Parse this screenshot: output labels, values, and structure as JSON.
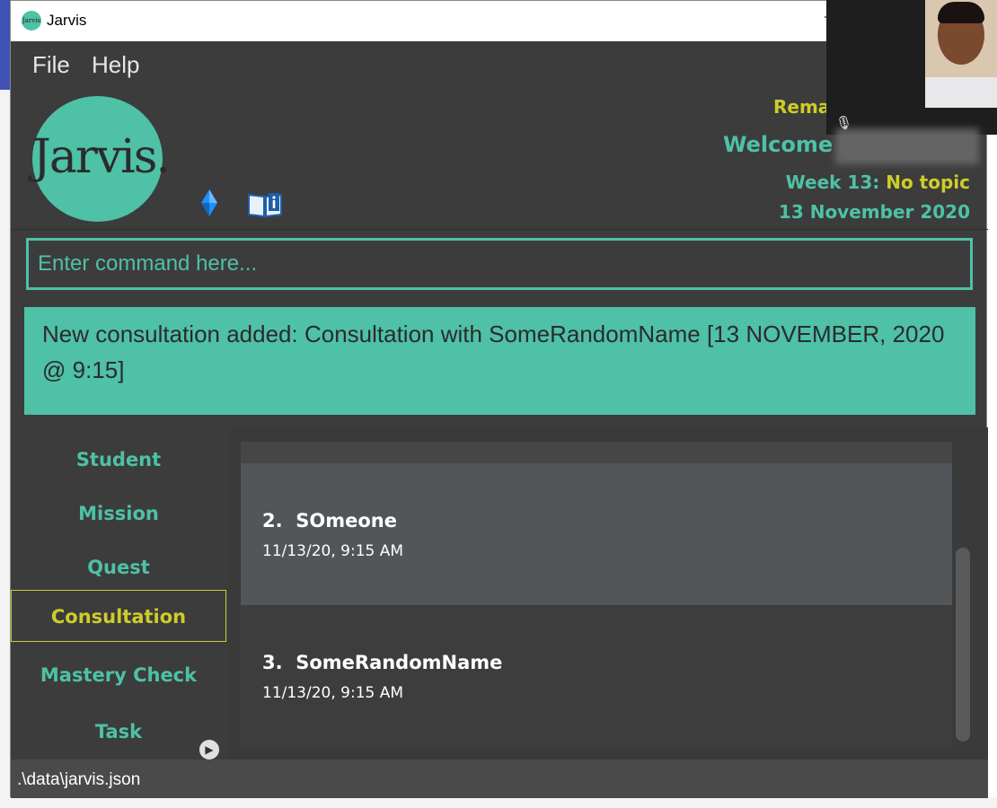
{
  "window": {
    "title": "Jarvis",
    "icon_text": "Jarvis"
  },
  "menu": {
    "items": [
      "File",
      "Help"
    ]
  },
  "header": {
    "logo_text": "Jarvis.",
    "remaining": "Remai",
    "welcome": "Welcome",
    "week_label": "Week 13:",
    "topic": "No topic",
    "date": "13 November 2020"
  },
  "command": {
    "placeholder": "Enter command here...",
    "value": ""
  },
  "result": {
    "message": "New consultation added: Consultation with SomeRandomName [13 NOVEMBER, 2020 @ 9:15]"
  },
  "tabs": [
    {
      "label": "Student",
      "active": false
    },
    {
      "label": "Mission",
      "active": false
    },
    {
      "label": "Quest",
      "active": false
    },
    {
      "label": "Consultation",
      "active": true
    },
    {
      "label": "Mastery Check",
      "active": false
    },
    {
      "label": "Task",
      "active": false
    }
  ],
  "consultations": [
    {
      "index": "2.",
      "name": "SOmeone",
      "time": "11/13/20, 9:15 AM"
    },
    {
      "index": "3.",
      "name": "SomeRandomName",
      "time": "11/13/20, 9:15 AM"
    }
  ],
  "status": {
    "path": ".\\data\\jarvis.json"
  },
  "colors": {
    "accent": "#4ec1a7",
    "highlight": "#cdcd2a",
    "background": "#3c3c3c"
  },
  "icons": [
    "diamond-icon",
    "book-info-icon",
    "chevron-right-icon",
    "minimize-icon"
  ]
}
